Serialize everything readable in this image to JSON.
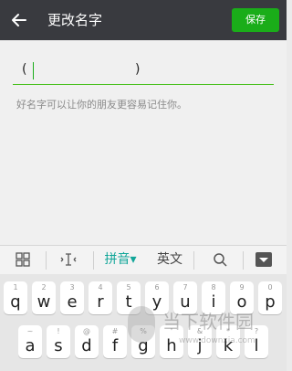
{
  "header": {
    "title": "更改名字",
    "save_label": "保存"
  },
  "name_field": {
    "open_paren": "(",
    "close_paren": ")"
  },
  "hint": "好名字可以让你的朋友更容易记住你。",
  "keyboard_bar": {
    "grid_icon": "grid-icon",
    "cursor_icon": "cursor-icon",
    "pinyin_label": "拼音▾",
    "english_label": "英文",
    "search_icon": "search-icon",
    "hide_icon": "hide-keyboard-icon"
  },
  "keyboard": {
    "row1": [
      {
        "l": "q",
        "n": "1"
      },
      {
        "l": "w",
        "n": "2"
      },
      {
        "l": "e",
        "n": "3"
      },
      {
        "l": "r",
        "n": "4"
      },
      {
        "l": "t",
        "n": "5"
      },
      {
        "l": "y",
        "n": "6"
      },
      {
        "l": "u",
        "n": "7"
      },
      {
        "l": "i",
        "n": "8"
      },
      {
        "l": "o",
        "n": "9"
      },
      {
        "l": "p",
        "n": "0"
      }
    ],
    "row2": [
      {
        "l": "a",
        "n": "~"
      },
      {
        "l": "s",
        "n": "!"
      },
      {
        "l": "d",
        "n": "@"
      },
      {
        "l": "f",
        "n": "#"
      },
      {
        "l": "g",
        "n": "%"
      },
      {
        "l": "h",
        "n": "'"
      },
      {
        "l": "j",
        "n": "&"
      },
      {
        "l": "k",
        "n": "*"
      },
      {
        "l": "l",
        "n": "?"
      }
    ]
  },
  "watermark": {
    "text": "当下软件园",
    "url": "www.downxia.com"
  }
}
